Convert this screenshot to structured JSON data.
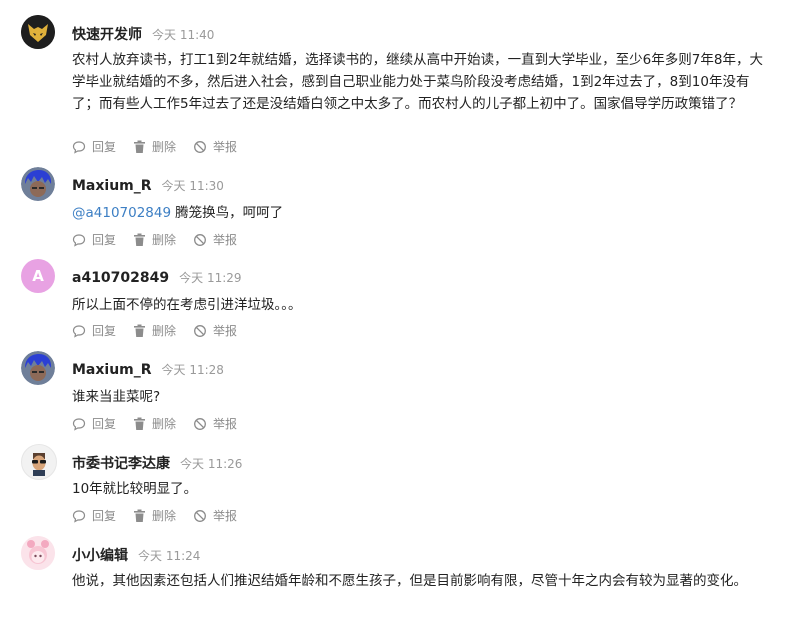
{
  "comments": [
    {
      "user": "快速开发师",
      "time": "今天 11:40",
      "avatar": "fox-mask-icon",
      "text": "农村人放弃读书，打工1到2年就结婚，选择读书的，继续从高中开始读，一直到大学毕业，至少6年多则7年8年，大学毕业就结婚的不多，然后进入社会，感到自己职业能力处于菜鸟阶段没考虑结婚，1到2年过去了，8到10年没有了；而有些人工作5年过去了还是没结婚白领之中太多了。而农村人的儿子都上初中了。国家倡导学历政策错了？"
    },
    {
      "user": "Maxium_R",
      "time": "今天 11:30",
      "avatar": "blue-hair-icon",
      "mention": "@a410702849",
      "text": "腾笼换鸟，呵呵了"
    },
    {
      "user": "a410702849",
      "time": "今天 11:29",
      "avatar_letter": "A",
      "avatar_color": "#e8a2e3",
      "text": "所以上面不停的在考虑引进洋垃圾。。。"
    },
    {
      "user": "Maxium_R",
      "time": "今天 11:28",
      "avatar": "blue-hair-icon",
      "text": "谁来当韭菜呢?"
    },
    {
      "user": "市委书记李达康",
      "time": "今天 11:26",
      "avatar": "sunglasses-man-icon",
      "text": "10年就比较明显了。"
    },
    {
      "user": "小小编辑",
      "time": "今天 11:24",
      "avatar": "pink-girl-icon",
      "text": "他说，其他因素还包括人们推迟结婚年龄和不愿生孩子，但是目前影响有限，尽管十年之内会有较为显著的变化。"
    }
  ],
  "actions": {
    "reply": "回复",
    "delete": "删除",
    "report": "举报"
  },
  "colors": {
    "link": "#3d7fc4",
    "muted": "#8c8c8c"
  }
}
